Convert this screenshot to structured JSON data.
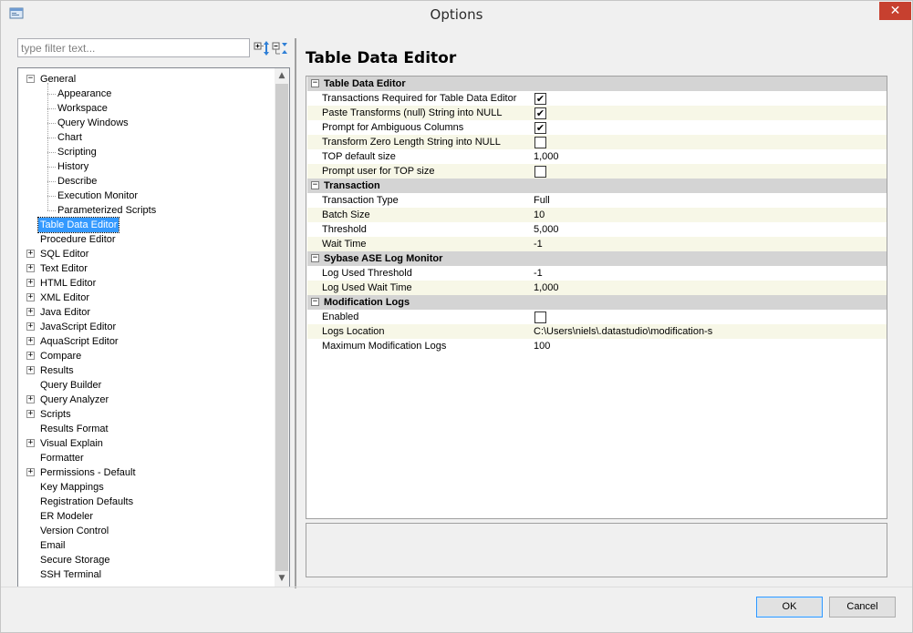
{
  "window": {
    "title": "Options",
    "close_glyph": "✕"
  },
  "filter": {
    "placeholder": "type filter text..."
  },
  "tree": {
    "general_label": "General",
    "general_children": [
      "Appearance",
      "Workspace",
      "Query Windows",
      "Chart",
      "Scripting",
      "History",
      "Describe",
      "Execution Monitor",
      "Parameterized Scripts"
    ],
    "items": [
      {
        "label": "Table Data Editor",
        "expandable": false,
        "selected": true
      },
      {
        "label": "Procedure Editor",
        "expandable": false
      },
      {
        "label": "SQL Editor",
        "expandable": true
      },
      {
        "label": "Text Editor",
        "expandable": true
      },
      {
        "label": "HTML Editor",
        "expandable": true
      },
      {
        "label": "XML Editor",
        "expandable": true
      },
      {
        "label": "Java Editor",
        "expandable": true
      },
      {
        "label": "JavaScript Editor",
        "expandable": true
      },
      {
        "label": "AquaScript Editor",
        "expandable": true
      },
      {
        "label": "Compare",
        "expandable": true
      },
      {
        "label": "Results",
        "expandable": true
      },
      {
        "label": "Query Builder",
        "expandable": false
      },
      {
        "label": "Query Analyzer",
        "expandable": true
      },
      {
        "label": "Scripts",
        "expandable": true
      },
      {
        "label": "Results Format",
        "expandable": false
      },
      {
        "label": "Visual Explain",
        "expandable": true
      },
      {
        "label": "Formatter",
        "expandable": false
      },
      {
        "label": "Permissions - Default",
        "expandable": true
      },
      {
        "label": "Key Mappings",
        "expandable": false
      },
      {
        "label": "Registration Defaults",
        "expandable": false
      },
      {
        "label": "ER Modeler",
        "expandable": false
      },
      {
        "label": "Version Control",
        "expandable": false
      },
      {
        "label": "Email",
        "expandable": false
      },
      {
        "label": "Secure Storage",
        "expandable": false
      },
      {
        "label": "SSH Terminal",
        "expandable": false
      }
    ]
  },
  "page": {
    "title": "Table Data Editor"
  },
  "sections": [
    {
      "title": "Table Data Editor",
      "props": [
        {
          "name": "Transactions Required for Table Data Editor",
          "type": "checkbox",
          "checked": true
        },
        {
          "name": "Paste Transforms (null) String into NULL",
          "type": "checkbox",
          "checked": true
        },
        {
          "name": "Prompt for Ambiguous Columns",
          "type": "checkbox",
          "checked": true
        },
        {
          "name": "Transform Zero Length String into NULL",
          "type": "checkbox",
          "checked": false
        },
        {
          "name": "TOP default size",
          "type": "text",
          "value": "1,000"
        },
        {
          "name": "Prompt user for TOP size",
          "type": "checkbox",
          "checked": false
        }
      ]
    },
    {
      "title": "Transaction",
      "props": [
        {
          "name": "Transaction Type",
          "type": "text",
          "value": "Full"
        },
        {
          "name": "Batch Size",
          "type": "text",
          "value": "10"
        },
        {
          "name": "Threshold",
          "type": "text",
          "value": "5,000"
        },
        {
          "name": "Wait Time",
          "type": "text",
          "value": "-1"
        }
      ]
    },
    {
      "title": "Sybase ASE Log Monitor",
      "props": [
        {
          "name": "Log Used Threshold",
          "type": "text",
          "value": "-1"
        },
        {
          "name": "Log Used Wait Time",
          "type": "text",
          "value": "1,000"
        }
      ]
    },
    {
      "title": "Modification Logs",
      "props": [
        {
          "name": "Enabled",
          "type": "checkbox",
          "checked": false
        },
        {
          "name": "Logs Location",
          "type": "text",
          "value": "C:\\Users\\niels\\.datastudio\\modification-s"
        },
        {
          "name": "Maximum Modification Logs",
          "type": "text",
          "value": "100"
        }
      ]
    }
  ],
  "buttons": {
    "ok": "OK",
    "cancel": "Cancel"
  },
  "colors": {
    "selection": "#3399ff",
    "section_header": "#d4d4d4",
    "alt_row": "#f7f7e7",
    "close_button": "#c7402f"
  }
}
